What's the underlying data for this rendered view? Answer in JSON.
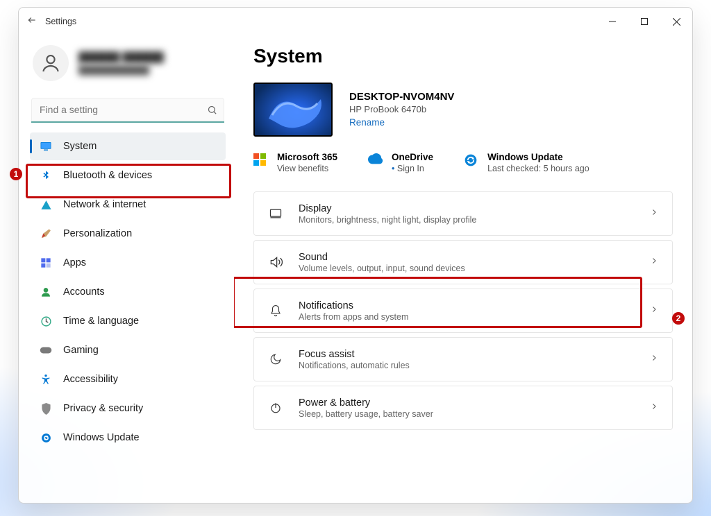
{
  "titlebar": {
    "title": "Settings"
  },
  "profile": {
    "name": "██████ ██████",
    "email": "████████████"
  },
  "search": {
    "placeholder": "Find a setting"
  },
  "sidebar": {
    "items": [
      {
        "label": "System",
        "icon": "monitor-icon"
      },
      {
        "label": "Bluetooth & devices",
        "icon": "bluetooth-icon"
      },
      {
        "label": "Network & internet",
        "icon": "wifi-icon"
      },
      {
        "label": "Personalization",
        "icon": "paintbrush-icon"
      },
      {
        "label": "Apps",
        "icon": "apps-icon"
      },
      {
        "label": "Accounts",
        "icon": "person-icon"
      },
      {
        "label": "Time & language",
        "icon": "clock-globe-icon"
      },
      {
        "label": "Gaming",
        "icon": "gamepad-icon"
      },
      {
        "label": "Accessibility",
        "icon": "accessibility-icon"
      },
      {
        "label": "Privacy & security",
        "icon": "shield-icon"
      },
      {
        "label": "Windows Update",
        "icon": "update-icon"
      }
    ]
  },
  "main": {
    "heading": "System",
    "device": {
      "name": "DESKTOP-NVOM4NV",
      "model": "HP ProBook 6470b",
      "rename": "Rename"
    },
    "status": {
      "ms365": {
        "title": "Microsoft 365",
        "sub": "View benefits"
      },
      "onedrive": {
        "title": "OneDrive",
        "sub": "Sign In"
      },
      "update": {
        "title": "Windows Update",
        "sub": "Last checked: 5 hours ago"
      }
    },
    "cards": [
      {
        "title": "Display",
        "sub": "Monitors, brightness, night light, display profile",
        "icon": "display-icon"
      },
      {
        "title": "Sound",
        "sub": "Volume levels, output, input, sound devices",
        "icon": "sound-icon"
      },
      {
        "title": "Notifications",
        "sub": "Alerts from apps and system",
        "icon": "bell-icon"
      },
      {
        "title": "Focus assist",
        "sub": "Notifications, automatic rules",
        "icon": "moon-icon"
      },
      {
        "title": "Power & battery",
        "sub": "Sleep, battery usage, battery saver",
        "icon": "power-icon"
      }
    ]
  },
  "annotations": {
    "badge1": "1",
    "badge2": "2"
  }
}
